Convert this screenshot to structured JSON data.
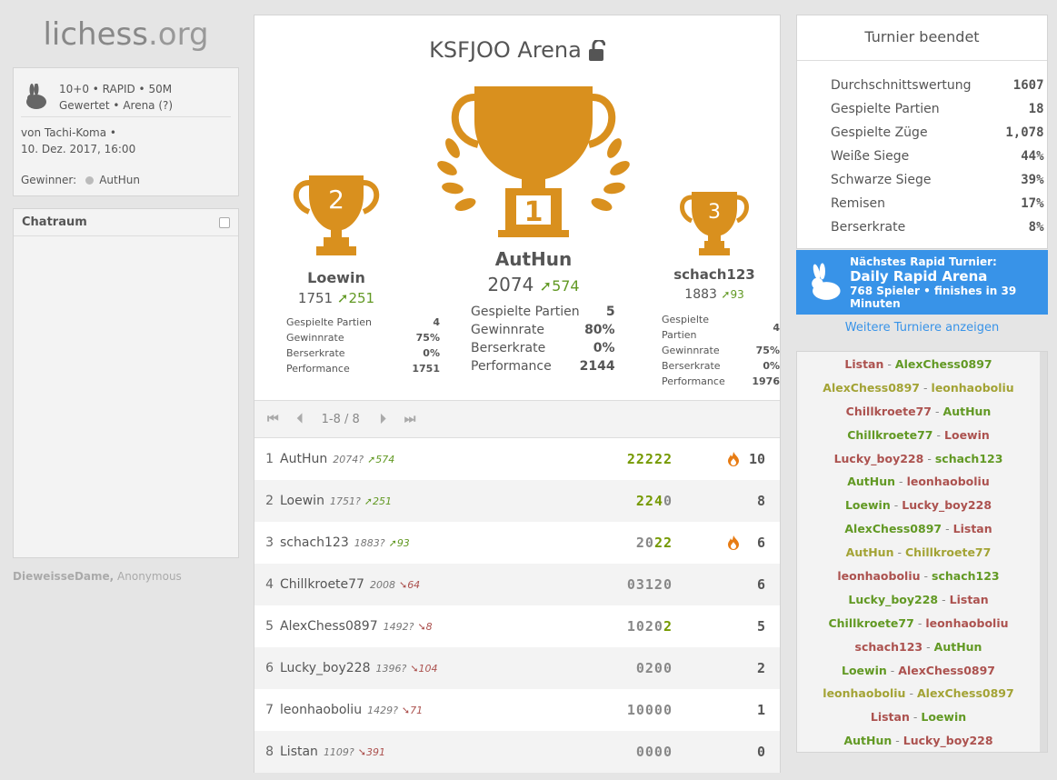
{
  "logo": {
    "main": "lichess",
    "tld": ".org"
  },
  "setup": {
    "line1": "10+0 • RAPID • 50M",
    "line2": "Gewertet • Arena (?)",
    "by": "von Tachi-Koma •",
    "date": "10. Dez. 2017, 16:00",
    "winner_label": "Gewinner:",
    "winner": "AutHun"
  },
  "chat": {
    "title": "Chatraum"
  },
  "watchers": {
    "bold": "DieweisseDame,",
    "rest": " Anonymous"
  },
  "tournament": {
    "title": "KSFJOO Arena"
  },
  "podium": [
    {
      "place": "2",
      "name": "Loewin",
      "rating": "1751",
      "prog": "251",
      "stats": [
        [
          "Gespielte Partien",
          "4"
        ],
        [
          "Gewinnrate",
          "75%"
        ],
        [
          "Berserkrate",
          "0%"
        ],
        [
          "Performance",
          "1751"
        ]
      ]
    },
    {
      "place": "1",
      "name": "AutHun",
      "rating": "2074",
      "prog": "574",
      "stats": [
        [
          "Gespielte Partien",
          "5"
        ],
        [
          "Gewinnrate",
          "80%"
        ],
        [
          "Berserkrate",
          "0%"
        ],
        [
          "Performance",
          "2144"
        ]
      ]
    },
    {
      "place": "3",
      "name": "schach123",
      "rating": "1883",
      "prog": "93",
      "stats": [
        [
          "Gespielte Partien",
          "4"
        ],
        [
          "Gewinnrate",
          "75%"
        ],
        [
          "Berserkrate",
          "0%"
        ],
        [
          "Performance",
          "1976"
        ]
      ]
    }
  ],
  "pager": {
    "first": "⏮",
    "prev": "⏴",
    "range": "1-8 / 8",
    "next": "⏵",
    "last": "⏭"
  },
  "standings": [
    {
      "rank": "1",
      "name": "AutHun",
      "rating": "2074?",
      "prog": "574",
      "dir": "up",
      "sheet": "22222",
      "hl": "all",
      "fire": true,
      "total": "10"
    },
    {
      "rank": "2",
      "name": "Loewin",
      "rating": "1751?",
      "prog": "251",
      "dir": "up",
      "sheet": "2240",
      "hl": "224",
      "fire": false,
      "total": "8"
    },
    {
      "rank": "3",
      "name": "schach123",
      "rating": "1883?",
      "prog": "93",
      "dir": "up",
      "sheet": "2022",
      "hl": "22",
      "fire": true,
      "total": "6"
    },
    {
      "rank": "4",
      "name": "Chillkroete77",
      "rating": "2008",
      "prog": "64",
      "dir": "down",
      "sheet": "03120",
      "hl": "",
      "fire": false,
      "total": "6"
    },
    {
      "rank": "5",
      "name": "AlexChess0897",
      "rating": "1492?",
      "prog": "8",
      "dir": "down",
      "sheet": "10202",
      "hl": "2last",
      "fire": false,
      "total": "5"
    },
    {
      "rank": "6",
      "name": "Lucky_boy228",
      "rating": "1396?",
      "prog": "104",
      "dir": "down",
      "sheet": "0200",
      "hl": "",
      "fire": false,
      "total": "2"
    },
    {
      "rank": "7",
      "name": "leonhaoboliu",
      "rating": "1429?",
      "prog": "71",
      "dir": "down",
      "sheet": "10000",
      "hl": "",
      "fire": false,
      "total": "1"
    },
    {
      "rank": "8",
      "name": "Listan",
      "rating": "1109?",
      "prog": "391",
      "dir": "down",
      "sheet": "0000",
      "hl": "",
      "fire": false,
      "total": "0"
    }
  ],
  "ended": {
    "title": "Turnier beendet",
    "stats": [
      [
        "Durchschnittswertung",
        "1607"
      ],
      [
        "Gespielte Partien",
        "18"
      ],
      [
        "Gespielte Züge",
        "1,078"
      ],
      [
        "Weiße Siege",
        "44%"
      ],
      [
        "Schwarze Siege",
        "39%"
      ],
      [
        "Remisen",
        "17%"
      ],
      [
        "Berserkrate",
        "8%"
      ]
    ]
  },
  "next": {
    "label": "Nächstes Rapid Turnier:",
    "name": "Daily Rapid Arena",
    "info": "768 Spieler • finishes in 39 Minuten"
  },
  "more_link": "Weitere Turniere anzeigen",
  "pairings": [
    {
      "w": "Listan",
      "wc": "l",
      "b": "AlexChess0897",
      "bc": "w"
    },
    {
      "w": "AlexChess0897",
      "wc": "d",
      "b": "leonhaoboliu",
      "bc": "d"
    },
    {
      "w": "Chillkroete77",
      "wc": "l",
      "b": "AutHun",
      "bc": "w"
    },
    {
      "w": "Chillkroete77",
      "wc": "w",
      "b": "Loewin",
      "bc": "l"
    },
    {
      "w": "Lucky_boy228",
      "wc": "l",
      "b": "schach123",
      "bc": "w"
    },
    {
      "w": "AutHun",
      "wc": "w",
      "b": "leonhaoboliu",
      "bc": "l"
    },
    {
      "w": "Loewin",
      "wc": "w",
      "b": "Lucky_boy228",
      "bc": "l"
    },
    {
      "w": "AlexChess0897",
      "wc": "w",
      "b": "Listan",
      "bc": "l"
    },
    {
      "w": "AutHun",
      "wc": "d",
      "b": "Chillkroete77",
      "bc": "d"
    },
    {
      "w": "leonhaoboliu",
      "wc": "l",
      "b": "schach123",
      "bc": "w"
    },
    {
      "w": "Lucky_boy228",
      "wc": "w",
      "b": "Listan",
      "bc": "l"
    },
    {
      "w": "Chillkroete77",
      "wc": "w",
      "b": "leonhaoboliu",
      "bc": "l"
    },
    {
      "w": "schach123",
      "wc": "l",
      "b": "AutHun",
      "bc": "w"
    },
    {
      "w": "Loewin",
      "wc": "w",
      "b": "AlexChess0897",
      "bc": "l"
    },
    {
      "w": "leonhaoboliu",
      "wc": "d",
      "b": "AlexChess0897",
      "bc": "d"
    },
    {
      "w": "Listan",
      "wc": "l",
      "b": "Loewin",
      "bc": "w"
    },
    {
      "w": "AutHun",
      "wc": "w",
      "b": "Lucky_boy228",
      "bc": "l"
    }
  ],
  "colors": {
    "trophy": "#d9901e",
    "win": "#629924",
    "loss": "#ac524f",
    "draw": "#a3a335",
    "accent": "#3893e8"
  }
}
